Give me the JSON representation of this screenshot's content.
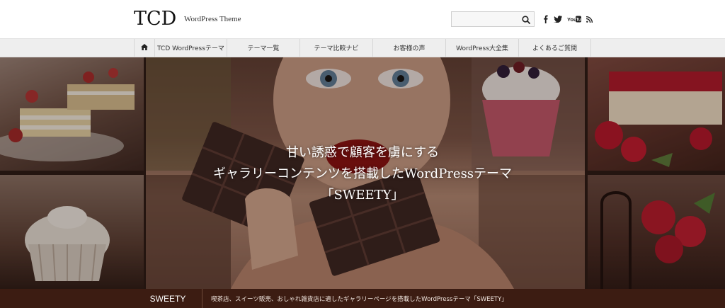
{
  "header": {
    "logo": "TCD",
    "tagline": "WordPress Theme",
    "search_placeholder": "",
    "social": {
      "youtube_label": "YouTube"
    }
  },
  "nav": {
    "items": [
      "TCD WordPressテーマ",
      "テーマ一覧",
      "テーマ比較ナビ",
      "お客様の声",
      "WordPress大全集",
      "よくあるご質問"
    ]
  },
  "hero": {
    "line1": "甘い誘惑で顧客を虜にする",
    "line2": "ギャラリーコンテンツを搭載したWordPressテーマ",
    "line3": "「SWEETY」"
  },
  "bottom": {
    "label": "SWEETY",
    "description": "喫茶店、スイーツ販売、おしゃれ雑貨店に適したギャラリーページを搭載したWordPressテーマ「SWEETY」"
  },
  "colors": {
    "nav_bg": "#eeeeee",
    "bottom_bar": "#3c1c12",
    "hero_text": "#ffffff"
  }
}
